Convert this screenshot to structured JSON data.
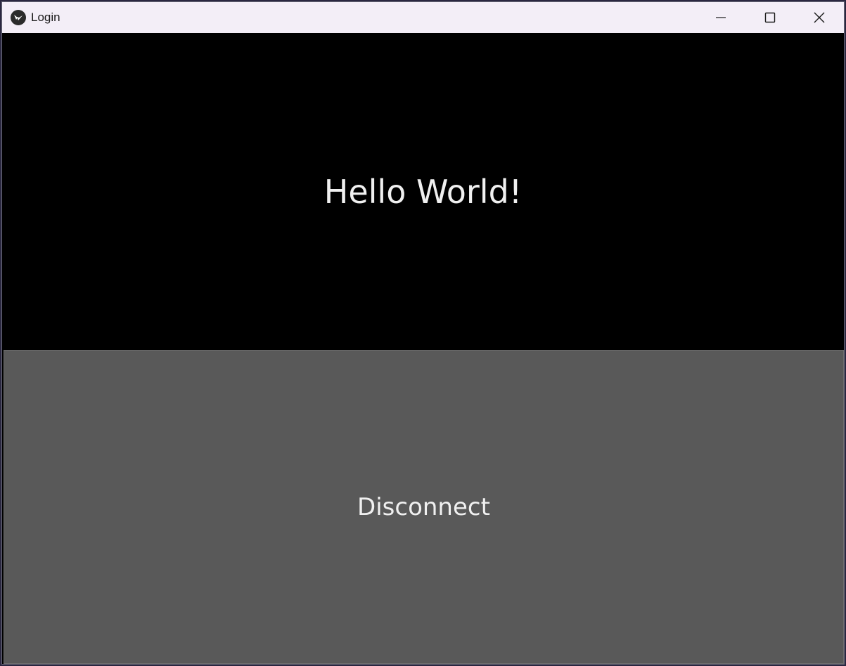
{
  "window": {
    "title": "Login",
    "icon": "kivy-logo-icon",
    "controls": [
      "minimize-icon",
      "maximize-icon",
      "close-icon"
    ]
  },
  "main": {
    "greeting": "Hello World!",
    "disconnect_label": "Disconnect"
  },
  "colors": {
    "titlebar": "#f3eef7",
    "background": "#000000",
    "button": "#595959",
    "text": "#f0f0f0"
  }
}
